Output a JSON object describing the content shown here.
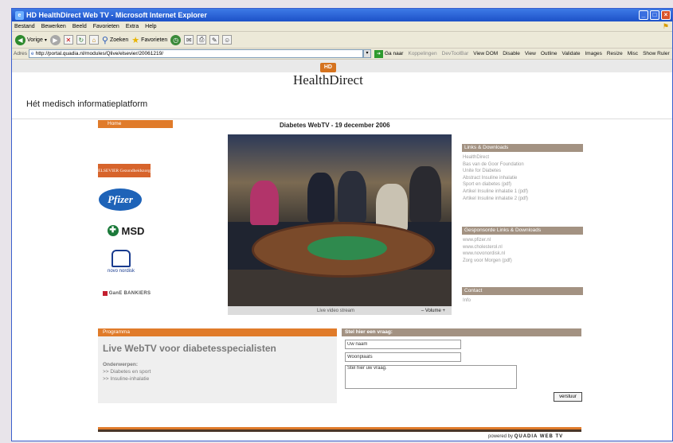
{
  "window": {
    "title": "HD   HealthDirect Web TV - Microsoft Internet Explorer",
    "menu": [
      "Bestand",
      "Bewerken",
      "Beeld",
      "Favorieten",
      "Extra",
      "Help"
    ]
  },
  "toolbar": {
    "back": "Vorige",
    "search": "Zoeken",
    "favorites": "Favorieten"
  },
  "address": {
    "label": "Adres",
    "url": "http://portal.quadia.nl/modules/Qlive/elsevier/20061219/",
    "go": "Ga naar",
    "links": [
      "Koppelingen",
      "DevToolBar"
    ],
    "devlinks": [
      "View DOM",
      "Disable",
      "View",
      "Outline",
      "Validate",
      "Images",
      "Resize",
      "Misc",
      "Show Ruler"
    ]
  },
  "site": {
    "logo_badge": "HD",
    "logo_text": "HealthDirect",
    "tagline": "Hét medisch informatieplatform",
    "home": "Home",
    "stage_title": "Diabetes WebTV - 19 december 2006"
  },
  "sponsors": {
    "elsevier": "ELSEVIER Gezondheidszorg",
    "pfizer": "Pfizer",
    "msd": "MSD",
    "novo": "novo nordisk",
    "garanti": "GanE BANKIERS"
  },
  "video": {
    "live_label": "Live video stream",
    "volume": "–  Volume  +"
  },
  "links": {
    "title": "Links & Downloads",
    "items": [
      "HealthDirect",
      "Bas van de Goor Foundation",
      "Unite for Diabetes",
      "Abstract Insuline inhalatie",
      "Sport en diabetes (pdf)",
      "Artikel Insuline inhalatie 1 (pdf)",
      "Artikel Insuline inhalatie 2 (pdf)"
    ]
  },
  "sponsored": {
    "title": "Gesponsorde Links & Downloads",
    "items": [
      "www.pfizer.nl",
      "www.cholesterol.nl",
      "www.novonordisk.nl",
      "Zorg voor Morgen (pdf)"
    ]
  },
  "contact": {
    "title": "Contact",
    "items": [
      "Info"
    ]
  },
  "programme": {
    "header": "Programma",
    "title": "Live WebTV voor diabetesspecialisten",
    "subjects_label": "Onderwerpen:",
    "subjects": [
      ">> Diabetes en sport",
      ">> Insuline-inhalatie"
    ]
  },
  "ask": {
    "header": "Stel hier een vraag:",
    "name_placeholder": "Uw naam",
    "place_placeholder": "Woonplaats",
    "message_placeholder": "Stel hier uw vraag.",
    "send": "verstuur"
  },
  "footer": {
    "powered_by": "powered by",
    "brand": "QUADIA WEB TV"
  }
}
